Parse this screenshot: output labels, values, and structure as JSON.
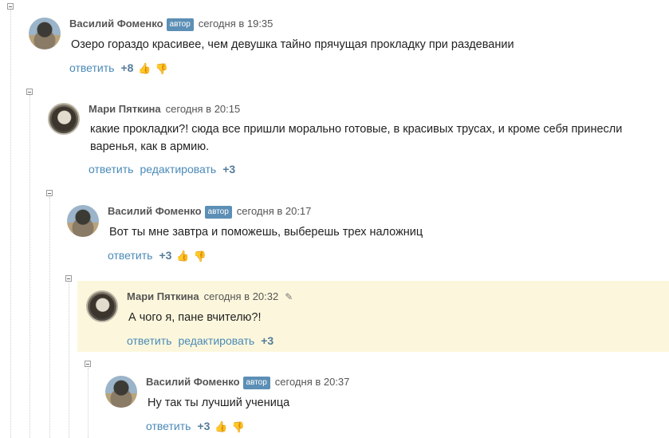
{
  "comments": [
    {
      "author": "Василий Фоменко",
      "badge": "автор",
      "time": "сегодня в 19:35",
      "text": "Озеро гораздо красивее, чем девушка тайно прячущая прокладку при раздевании",
      "reply": "ответить",
      "votes": "+8",
      "avatar_icon": "avatar-icon"
    },
    {
      "author": "Мари Пяткина",
      "time": "сегодня в 20:15",
      "text": "какие прокладки?! сюда все пришли морально готовые, в красивых трусах, и кроме себя принесли варенья, как в армию.",
      "reply": "ответить",
      "edit": "редактировать",
      "votes": "+3",
      "avatar_icon": "avatar-icon"
    },
    {
      "author": "Василий Фоменко",
      "badge": "автор",
      "time": "сегодня в 20:17",
      "text": "Вот ты мне завтра и поможешь, выберешь трех наложниц",
      "reply": "ответить",
      "votes": "+3",
      "avatar_icon": "avatar-icon"
    },
    {
      "author": "Мари Пяткина",
      "time": "сегодня в 20:32",
      "text": "А чого я, пане вчителю?!",
      "reply": "ответить",
      "edit": "редактировать",
      "votes": "+3",
      "avatar_icon": "avatar-icon",
      "edit_icon": "pencil-icon",
      "highlight_color": "#fcf7dc"
    },
    {
      "author": "Василий Фоменко",
      "badge": "автор",
      "time": "сегодня в 20:37",
      "text": "Ну так ты лучший ученица",
      "reply": "ответить",
      "votes": "+3",
      "avatar_icon": "avatar-icon"
    }
  ],
  "icons": {
    "vote_up": "thumbs-up-icon",
    "vote_down": "thumbs-down-icon",
    "collapse": "collapse-toggle-icon"
  },
  "colors": {
    "link": "#4a8ab8",
    "badge": "#5c8fb5",
    "vote_up": "#6fb044",
    "highlight": "#fcf7dc"
  }
}
